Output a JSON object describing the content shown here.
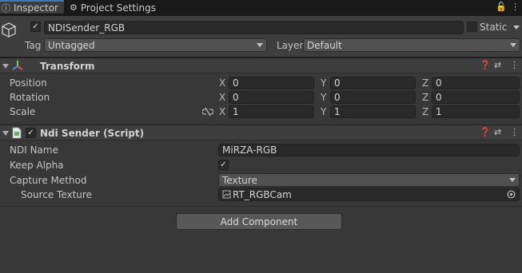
{
  "tabs": [
    {
      "label": "Inspector",
      "icon": "info-icon"
    },
    {
      "label": "Project Settings",
      "icon": "gear-icon"
    }
  ],
  "window_icons": [
    "lock-icon",
    "more-icon"
  ],
  "gameobject": {
    "active": true,
    "name": "NDISender_RGB",
    "static_label": "Static",
    "static_checked": false,
    "tag_label": "Tag",
    "tag_value": "Untagged",
    "layer_label": "Layer",
    "layer_value": "Default"
  },
  "transform": {
    "title": "Transform",
    "rows": [
      {
        "label": "Position",
        "x": "0",
        "y": "0",
        "z": "0"
      },
      {
        "label": "Rotation",
        "x": "0",
        "y": "0",
        "z": "0"
      },
      {
        "label": "Scale",
        "x": "1",
        "y": "1",
        "z": "1"
      }
    ],
    "axis_labels": [
      "X",
      "Y",
      "Z"
    ]
  },
  "ndi_sender": {
    "title": "Ndi Sender (Script)",
    "enabled": true,
    "fields": {
      "ndi_name_label": "NDI Name",
      "ndi_name_value": "MiRZA-RGB",
      "keep_alpha_label": "Keep Alpha",
      "keep_alpha_checked": true,
      "capture_method_label": "Capture Method",
      "capture_method_value": "Texture",
      "source_texture_label": "Source Texture",
      "source_texture_value": "RT_RGBCam"
    }
  },
  "add_component_label": "Add Component",
  "colors": {
    "background": "#383838",
    "tab_accent": "#3a79bb",
    "header_bg": "#3e3e3e",
    "field_bg": "#2a2a2a",
    "button_bg": "#585858"
  }
}
